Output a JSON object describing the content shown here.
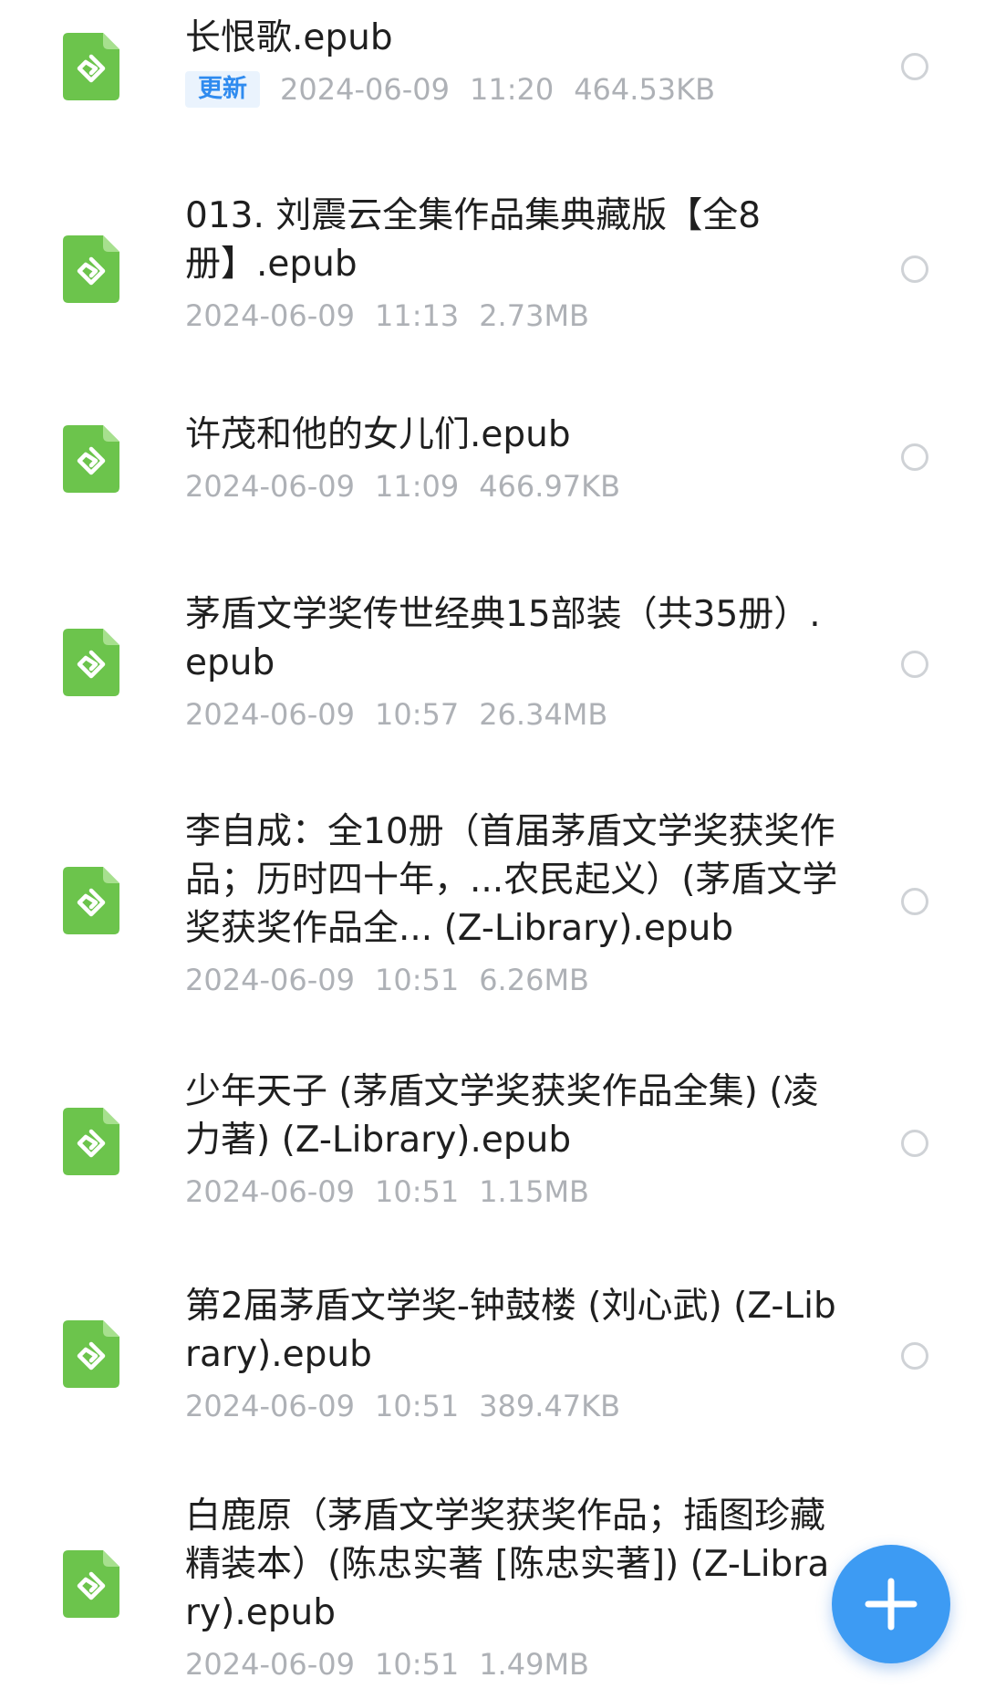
{
  "colors": {
    "icon_green": "#6cc44c",
    "accent_blue": "#3d9bf3",
    "badge_text": "#2f8bef",
    "meta_gray": "#aeb1b6"
  },
  "files": [
    {
      "name": "长恨歌.epub",
      "badge": "更新",
      "date": "2024-06-09",
      "time": "11:20",
      "size": "464.53KB",
      "icon": "epub-file-icon"
    },
    {
      "name": "013. 刘震云全集作品集典藏版【全8册】.epub",
      "date": "2024-06-09",
      "time": "11:13",
      "size": "2.73MB",
      "icon": "epub-file-icon"
    },
    {
      "name": "许茂和他的女儿们.epub",
      "date": "2024-06-09",
      "time": "11:09",
      "size": "466.97KB",
      "icon": "epub-file-icon"
    },
    {
      "name": "茅盾文学奖传世经典15部装（共35册）.epub",
      "date": "2024-06-09",
      "time": "10:57",
      "size": "26.34MB",
      "icon": "epub-file-icon"
    },
    {
      "name": "李自成：全10册（首届茅盾文学奖获奖作品；历时四十年，...农民起义）(茅盾文学奖获奖作品全... (Z-Library).epub",
      "date": "2024-06-09",
      "time": "10:51",
      "size": "6.26MB",
      "icon": "epub-file-icon"
    },
    {
      "name": "少年天子 (茅盾文学奖获奖作品全集) (凌力著) (Z-Library).epub",
      "date": "2024-06-09",
      "time": "10:51",
      "size": "1.15MB",
      "icon": "epub-file-icon"
    },
    {
      "name": "第2届茅盾文学奖-钟鼓楼 (刘心武) (Z-Library).epub",
      "date": "2024-06-09",
      "time": "10:51",
      "size": "389.47KB",
      "icon": "epub-file-icon"
    },
    {
      "name": "白鹿原（茅盾文学奖获奖作品；插图珍藏精装本）(陈忠实著 [陈忠实著]) (Z-Library).epub",
      "date": "2024-06-09",
      "time": "10:51",
      "size": "1.49MB",
      "icon": "epub-file-icon"
    }
  ],
  "fab": {
    "icon": "plus-icon"
  }
}
